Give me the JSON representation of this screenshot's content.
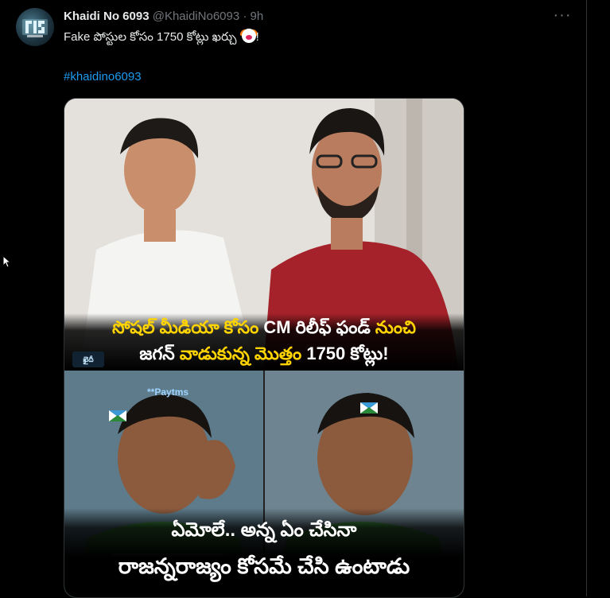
{
  "tweet": {
    "display_name": "Khaidi No 6093",
    "handle": "@KhaidiNo6093",
    "separator": "·",
    "time": "9h",
    "more_label": "···",
    "text": "Fake పోస్టుల కోసం 1750 కోట్లు ఖర్చు",
    "text_suffix": "!",
    "emoji": "clown-face",
    "hashtag": "#khaidino6093"
  },
  "media": {
    "top_caption": {
      "line1_part1": "సోషల్ మీడియా కోసం",
      "line1_part2": "CM రిలీఫ్ ఫండ్",
      "line1_part3": "నుంచి",
      "line2_part1": "జగన్",
      "line2_part2": "వాడుకున్న",
      "line2_part3": "మొత్తం",
      "line2_part4": "1750 కోట్లు!"
    },
    "watermark": "ఖైదీ",
    "paytms_label": "**Paytms",
    "bottom_caption": {
      "line1": "ఏమోలే.. అన్న ఏం చేసినా",
      "line2": "రాజన్నరాజ్యం కోసమే చేసి ఉంటాడు"
    }
  },
  "colors": {
    "background": "#000000",
    "link": "#1d9bf0",
    "secondary_text": "#71767b",
    "caption_highlight": "#ffd400"
  }
}
